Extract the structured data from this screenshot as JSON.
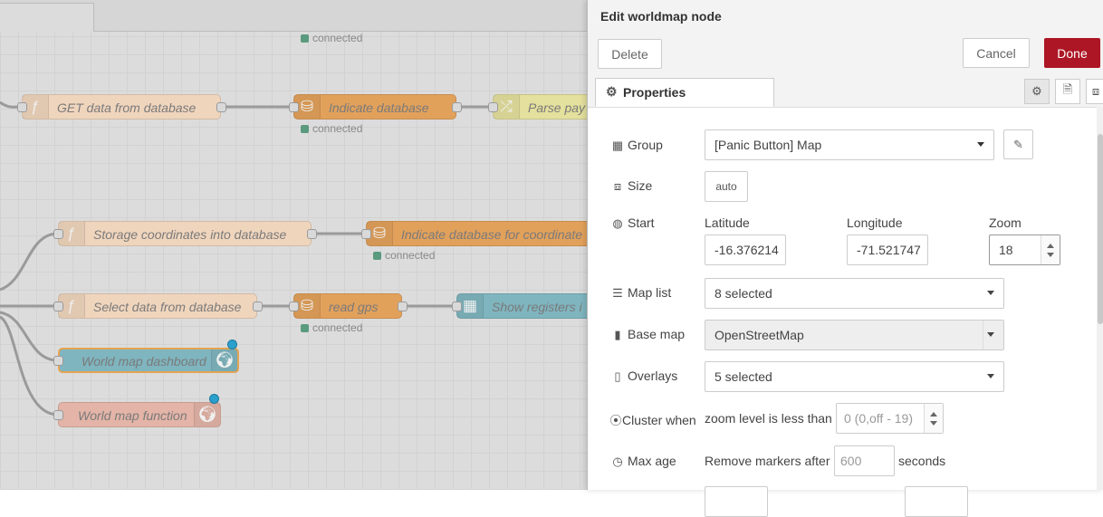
{
  "canvas": {
    "nodes": [
      {
        "id": "n1",
        "label": "GET data from database",
        "icon": "function-icon"
      },
      {
        "id": "n2",
        "label": "Indicate database",
        "icon": "database-icon"
      },
      {
        "id": "n3",
        "label": "Parse pay",
        "icon": "json-icon"
      },
      {
        "id": "n4",
        "label": "Storage coordinates into database",
        "icon": "function-icon"
      },
      {
        "id": "n5",
        "label": "Indicate database for coordinate",
        "icon": "database-icon"
      },
      {
        "id": "n6",
        "label": "Select data from database",
        "icon": "function-icon"
      },
      {
        "id": "n7",
        "label": "read gps",
        "icon": "database-icon"
      },
      {
        "id": "n8",
        "label": "Show registers i",
        "icon": "table-icon"
      },
      {
        "id": "n9",
        "label": "World map dashboard",
        "icon": "globe-icon"
      },
      {
        "id": "n10",
        "label": "World map function",
        "icon": "globe-icon"
      }
    ],
    "status_connected": "connected"
  },
  "tray": {
    "title": "Edit worldmap node",
    "delete_label": "Delete",
    "cancel_label": "Cancel",
    "done_label": "Done",
    "properties_tab": "Properties",
    "colors": {
      "done": "#ad1625",
      "function_node": "#f0d5bd",
      "database_node": "#e2a15b",
      "map_node": "#7fb5bf",
      "map_func_node": "#e3b4a7"
    }
  },
  "form": {
    "group_label": "Group",
    "group_value": "[Panic Button] Map",
    "size_label": "Size",
    "size_value": "auto",
    "start_label": "Start",
    "latitude_label": "Latitude",
    "latitude_value": "-16.376214",
    "longitude_label": "Longitude",
    "longitude_value": "-71.521747",
    "zoom_label": "Zoom",
    "zoom_value": "18",
    "maplist_label": "Map list",
    "maplist_value": "8 selected",
    "basemap_label": "Base map",
    "basemap_value": "OpenStreetMap",
    "overlays_label": "Overlays",
    "overlays_value": "5 selected",
    "cluster_label": "Cluster when",
    "cluster_text": "zoom level is less than",
    "cluster_placeholder": "0 (0,off - 19)",
    "maxage_label": "Max age",
    "maxage_text": "Remove markers after",
    "maxage_placeholder": "600",
    "maxage_unit": "seconds"
  }
}
